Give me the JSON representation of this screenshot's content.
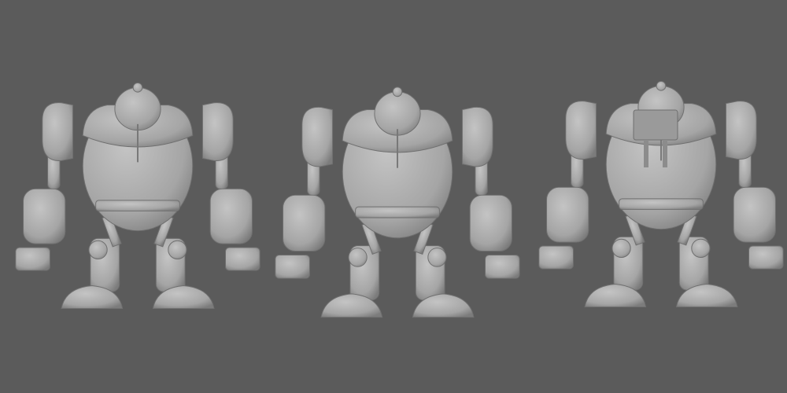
{
  "scene": {
    "background_color": "#5b5b5b",
    "model_color": "#a9a9a9",
    "shadow_color": "#7c7c7c",
    "highlight_color": "#c4c4c4",
    "views": [
      "front",
      "three-quarter",
      "back"
    ]
  }
}
